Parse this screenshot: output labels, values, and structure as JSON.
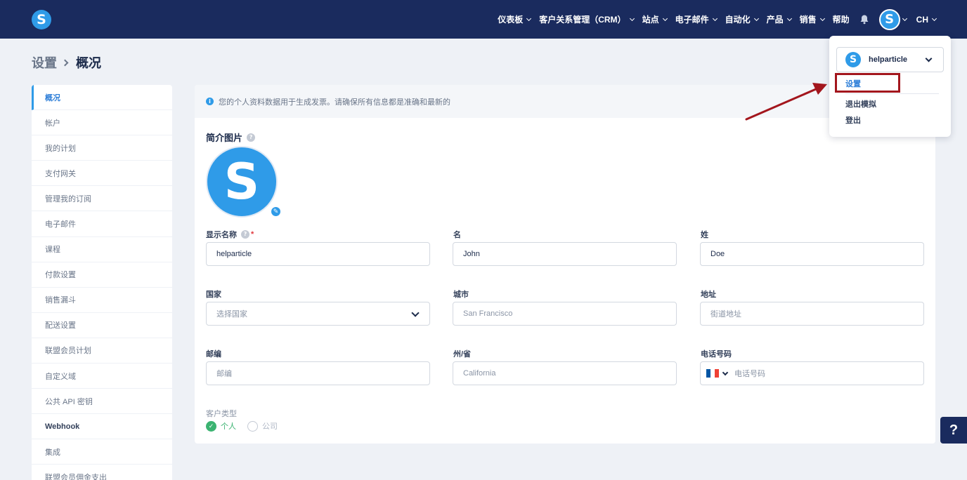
{
  "app": {
    "logo_letter": "S"
  },
  "nav": {
    "items": [
      {
        "label": "仪表板",
        "dropdown": true
      },
      {
        "label": "客户关系管理（CRM）",
        "dropdown": true
      },
      {
        "label": "站点",
        "dropdown": true
      },
      {
        "label": "电子邮件",
        "dropdown": true
      },
      {
        "label": "自动化",
        "dropdown": true
      },
      {
        "label": "产品",
        "dropdown": true
      },
      {
        "label": "销售",
        "dropdown": true
      },
      {
        "label": "帮助",
        "dropdown": false
      }
    ],
    "avatar_letter": "S",
    "language": "CH"
  },
  "breadcrumb": {
    "root": "设置",
    "current": "概况"
  },
  "sidebar": {
    "items": [
      "概况",
      "帐户",
      "我的计划",
      "支付网关",
      "管理我的订阅",
      "电子邮件",
      "课程",
      "付款设置",
      "销售漏斗",
      "配送设置",
      "联盟会员计划",
      "自定义域",
      "公共 API 密钥",
      "Webhook",
      "集成",
      "联盟会员佣金支出"
    ],
    "active_index": 0
  },
  "main": {
    "info_text": "您的个人资料数据用于生成发票。请确保所有信息都是准确和最新的",
    "profile_title": "简介图片",
    "profile_letter": "S",
    "fields": {
      "display_name": {
        "label": "显示名称",
        "value": "helparticle"
      },
      "first_name": {
        "label": "名",
        "value": "John"
      },
      "last_name": {
        "label": "姓",
        "value": "Doe"
      },
      "country": {
        "label": "国家",
        "placeholder": "选择国家"
      },
      "city": {
        "label": "城市",
        "placeholder": "San Francisco"
      },
      "address": {
        "label": "地址",
        "placeholder": "街道地址"
      },
      "zip": {
        "label": "邮编",
        "placeholder": "邮编"
      },
      "state": {
        "label": "州/省",
        "placeholder": "California"
      },
      "phone": {
        "label": "电话号码",
        "placeholder": "电话号码"
      }
    },
    "customer_type": {
      "label": "客户类型",
      "options": [
        "个人",
        "公司"
      ],
      "selected": "个人"
    }
  },
  "dropdown": {
    "username": "helparticle",
    "avatar_letter": "S",
    "items": [
      "设置",
      "退出模拟",
      "登出"
    ]
  },
  "help_fab": "?",
  "colors": {
    "nav_bg": "#1a2b5e",
    "accent": "#2f9be8",
    "highlight": "#a3161d",
    "success": "#3bb371"
  }
}
